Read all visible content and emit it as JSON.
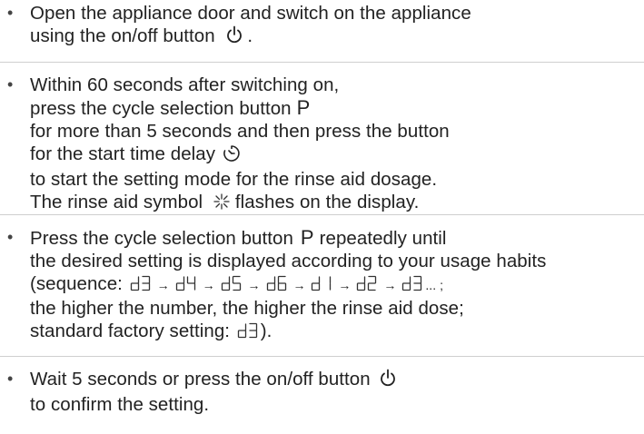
{
  "icons": {
    "power": "power-icon",
    "clock": "start-time-delay-icon",
    "rinse": "rinse-aid-icon"
  },
  "step1": {
    "line1": "Open the appliance door and switch on the appliance",
    "line2_a": "using the on/off button",
    "line2_b": "."
  },
  "step2": {
    "line1": "Within 60 seconds after switching on,",
    "line2": "press the cycle selection button",
    "p_symbol": "P",
    "line3": "for more than 5 seconds and then press the button",
    "line4": "for the start time delay",
    "line5": "to start the setting mode for the rinse aid dosage.",
    "line6_a": "The rinse aid symbol",
    "line6_b": "flashes on the display."
  },
  "step3": {
    "line1_a": "Press the cycle selection button",
    "p_symbol": "P",
    "line1_b": "repeatedly until",
    "line2": "the desired setting is displayed according to your usage habits",
    "line3_a": "(sequence:",
    "arrow": "→",
    "sequence": [
      "d3",
      "d4",
      "d5",
      "d6",
      "d1",
      "d2",
      "d3"
    ],
    "ellipsis": "... ;",
    "line4": "the higher the number, the higher the rinse aid dose;",
    "line5_a": "standard factory setting:",
    "factory_setting": "d3",
    "line5_b": ")."
  },
  "step4": {
    "line1_a": "Wait 5 seconds or press the on/off button",
    "line2": "to confirm the setting."
  },
  "bullet": "•"
}
